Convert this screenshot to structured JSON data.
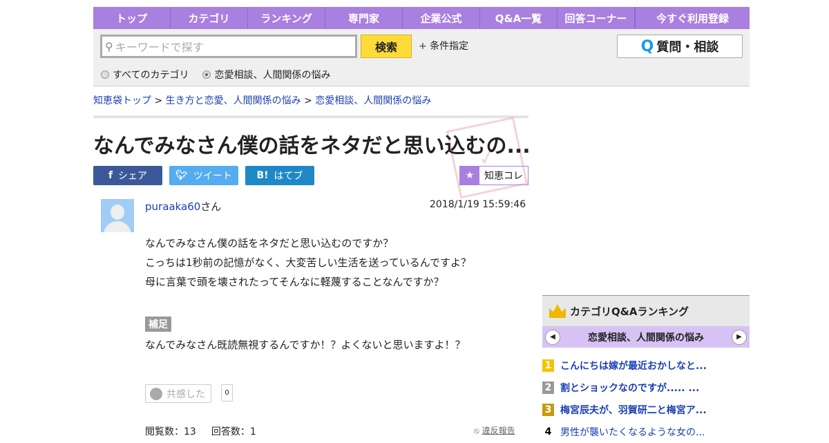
{
  "nav": [
    "トップ",
    "カテゴリ",
    "ランキング",
    "専門家",
    "企業公式",
    "Q&A一覧",
    "回答コーナー",
    "今すぐ利用登録"
  ],
  "search": {
    "placeholder": "キーワードで探す",
    "button": "検索",
    "conditions": "条件指定",
    "ask": "質問・相談",
    "ask_icon": "Q",
    "radio_all": "すべてのカテゴリ",
    "radio_cat": "恋愛相談、人間関係の悩み"
  },
  "breadcrumb": [
    "知恵袋トップ",
    "生き方と恋愛、人間関係の悩み",
    "恋愛相談、人間関係の悩み"
  ],
  "title": "なんでみなさん僕の話をネタだと思い込むの...",
  "stamp": "解決済",
  "share": {
    "facebook": "シェア",
    "twitter": "ツイート",
    "hatena": "はてブ",
    "chiekore": "知恵コレ"
  },
  "question": {
    "user": "puraaka60",
    "suffix": "さん",
    "date": "2018/1/19  15:59:46",
    "lines": [
      "なんでみなさん僕の話をネタだと思い込むのですか？",
      "こっちは1秒前の記憶がなく、大変苦しい生活を送っているんですよ？",
      "母に言葉で頭を壊されたってそんなに軽蔑することなんですか？"
    ],
    "hosoku_label": "補足",
    "hosoku": "なんでみなさん既読無視するんですか！？よくないと思いますよ！？",
    "empathy": "共感した",
    "empathy_count": "0",
    "views": "閲覧数：13",
    "answers": "回答数：1",
    "report": "違反報告"
  },
  "ranking": {
    "title": "カテゴリQ&Aランキング",
    "category": "恋愛相談、人間関係の悩み",
    "items": [
      {
        "n": "1",
        "t": "こんにちは嫁が最近おかしなと...",
        "c": "#f5c400"
      },
      {
        "n": "2",
        "t": "割とショックなのですが..... ...",
        "c": "#999999"
      },
      {
        "n": "3",
        "t": "梅宮辰夫が、羽賀研二と梅宮ア...",
        "c": "#c89a10"
      },
      {
        "n": "4",
        "t": "男性が襲いたくなるような女の...",
        "c": ""
      }
    ]
  }
}
